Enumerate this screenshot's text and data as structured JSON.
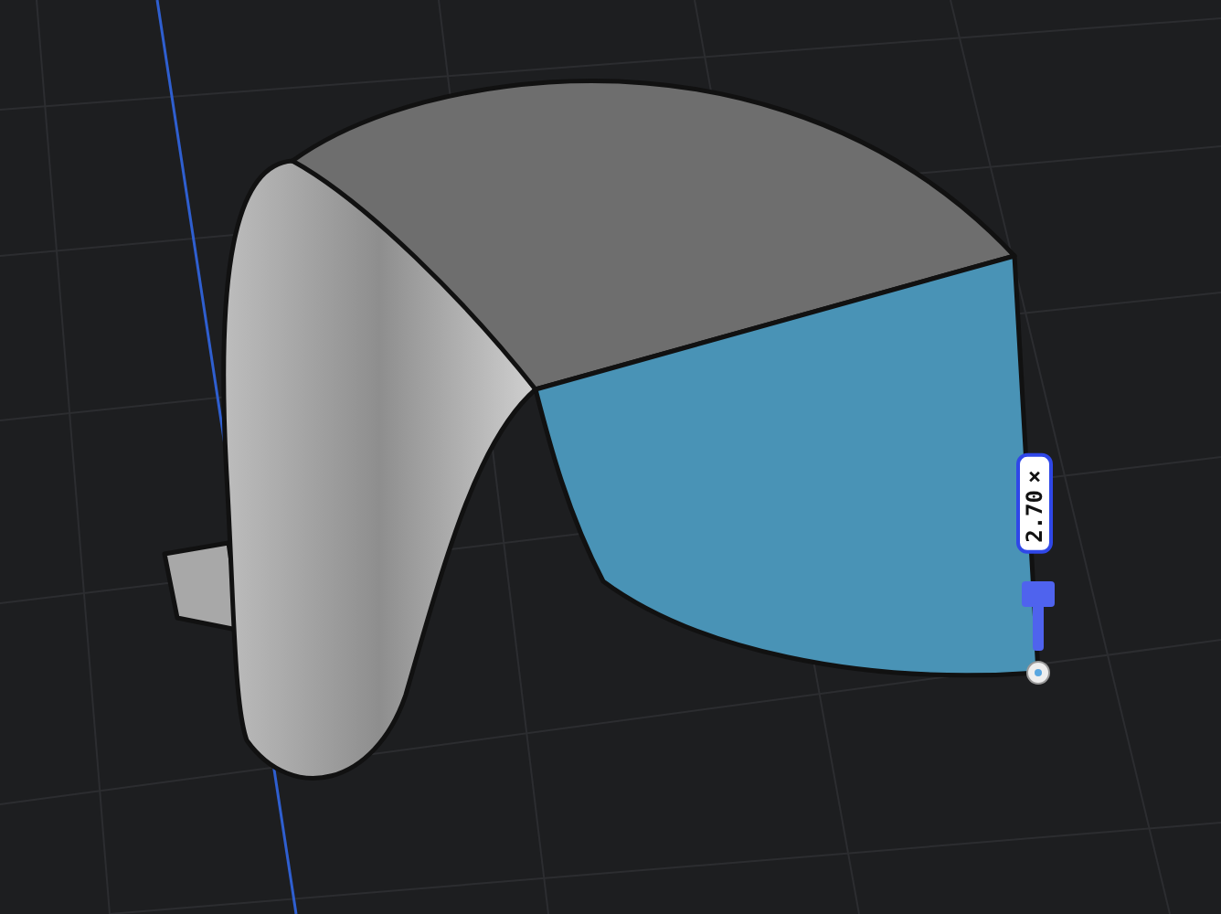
{
  "viewport": {
    "dimension_label": "2.70×"
  }
}
